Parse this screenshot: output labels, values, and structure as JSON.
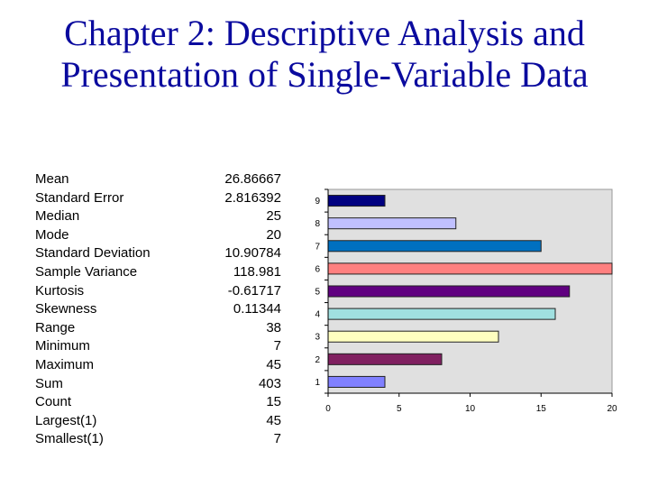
{
  "slide": {
    "title": "Chapter 2: Descriptive Analysis and Presentation of Single-Variable Data",
    "title_color": "#0a0a9e"
  },
  "stats": [
    {
      "label": "Mean",
      "value": "26.86667"
    },
    {
      "label": "Standard Error",
      "value": "2.816392"
    },
    {
      "label": "Median",
      "value": "25"
    },
    {
      "label": "Mode",
      "value": "20"
    },
    {
      "label": "Standard Deviation",
      "value": "10.90784"
    },
    {
      "label": "Sample Variance",
      "value": "118.981"
    },
    {
      "label": "Kurtosis",
      "value": "-0.61717"
    },
    {
      "label": "Skewness",
      "value": "0.11344"
    },
    {
      "label": "Range",
      "value": "38"
    },
    {
      "label": "Minimum",
      "value": "7"
    },
    {
      "label": "Maximum",
      "value": "45"
    },
    {
      "label": "Sum",
      "value": "403"
    },
    {
      "label": "Count",
      "value": "15"
    },
    {
      "label": "Largest(1)",
      "value": "45"
    },
    {
      "label": "Smallest(1)",
      "value": "7"
    }
  ],
  "chart_data": {
    "type": "bar",
    "orientation": "horizontal",
    "title": "",
    "xlabel": "",
    "ylabel": "",
    "categories": [
      "1",
      "2",
      "3",
      "4",
      "5",
      "6",
      "7",
      "8",
      "9"
    ],
    "values": [
      4,
      8,
      12,
      16,
      17,
      20,
      15,
      9,
      4
    ],
    "colors": [
      "#8080ff",
      "#802060",
      "#ffffc0",
      "#a0e0e0",
      "#600080",
      "#ff8080",
      "#0070c0",
      "#c0c0ff",
      "#000080"
    ],
    "xlim": [
      0,
      20
    ],
    "xticks": [
      "0",
      "5",
      "10",
      "15",
      "20"
    ],
    "plot_background": "#e0e0e0",
    "grid": false,
    "legend": "none"
  }
}
